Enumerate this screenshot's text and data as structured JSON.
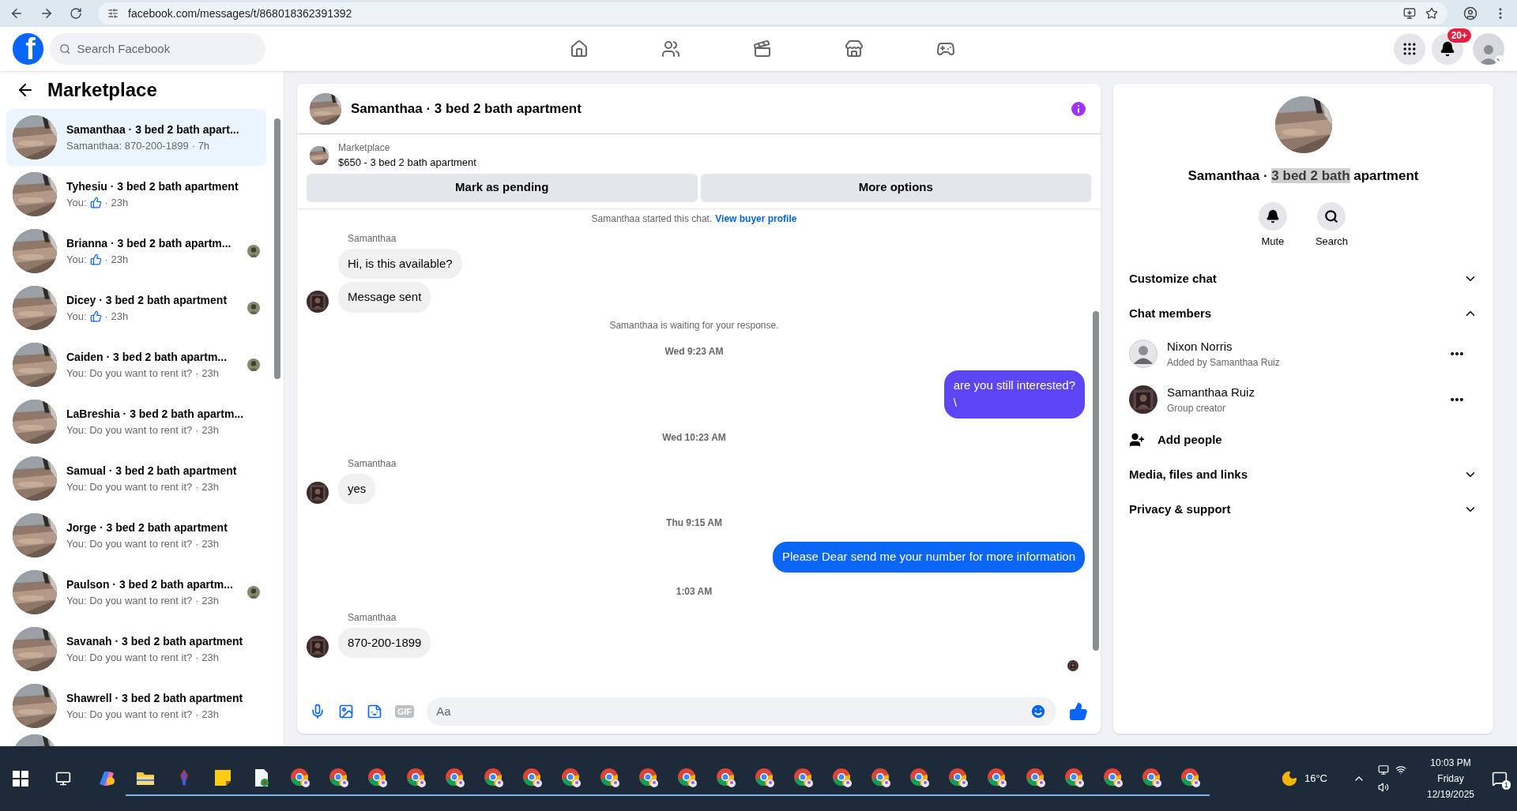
{
  "browser": {
    "url": "facebook.com/messages/t/868018362391392"
  },
  "nav": {
    "logo": "f",
    "search_placeholder": "Search Facebook",
    "notification_badge": "20+"
  },
  "sidebar": {
    "title": "Marketplace",
    "conversations": [
      {
        "title": "Samanthaa · 3 bed 2 bath apart...",
        "kind": "text",
        "preview": "Samanthaa: 870-200-1899",
        "time": "· 7h",
        "selected": true,
        "seen": false
      },
      {
        "title": "Tyhesiu · 3 bed 2 bath apartment",
        "kind": "like",
        "preview": "You:",
        "time": "· 23h",
        "selected": false,
        "seen": false
      },
      {
        "title": "Brianna · 3 bed 2 bath apartm...",
        "kind": "like",
        "preview": "You:",
        "time": "· 23h",
        "selected": false,
        "seen": true
      },
      {
        "title": "Dicey · 3 bed 2 bath apartment",
        "kind": "like",
        "preview": "You:",
        "time": "· 23h",
        "selected": false,
        "seen": true
      },
      {
        "title": "Caiden · 3 bed 2 bath apartm...",
        "kind": "text",
        "preview": "You: Do you want to rent it?",
        "time": "· 23h",
        "selected": false,
        "seen": true
      },
      {
        "title": "LaBreshia · 3 bed 2 bath apartm...",
        "kind": "text",
        "preview": "You: Do you want to rent it?",
        "time": "· 23h",
        "selected": false,
        "seen": false
      },
      {
        "title": "Samual · 3 bed 2 bath apartment",
        "kind": "text",
        "preview": "You: Do you want to rent it?",
        "time": "· 23h",
        "selected": false,
        "seen": false
      },
      {
        "title": "Jorge · 3 bed 2 bath apartment",
        "kind": "text",
        "preview": "You: Do you want to rent it?",
        "time": "· 23h",
        "selected": false,
        "seen": false
      },
      {
        "title": "Paulson · 3 bed 2 bath apartm...",
        "kind": "text",
        "preview": "You: Do you want to rent it?",
        "time": "· 23h",
        "selected": false,
        "seen": true
      },
      {
        "title": "Savanah · 3 bed 2 bath apartment",
        "kind": "text",
        "preview": "You: Do you want to rent it?",
        "time": "· 23h",
        "selected": false,
        "seen": false
      },
      {
        "title": "Shawrell · 3 bed 2 bath apartment",
        "kind": "text",
        "preview": "You: Do you want to rent it?",
        "time": "· 23h",
        "selected": false,
        "seen": false
      }
    ]
  },
  "chat": {
    "title": "Samanthaa · 3 bed 2 bath apartment",
    "listing": {
      "source": "Marketplace",
      "title": "$650 - 3 bed 2 bath apartment"
    },
    "actions": [
      "Mark as pending",
      "More options"
    ],
    "messages": [
      {
        "kind": "system",
        "text": "Samanthaa started this chat.",
        "link": "View buyer profile"
      },
      {
        "kind": "incoming",
        "sender": "Samanthaa",
        "bubbles": [
          "Hi, is this available?",
          "Message sent"
        ]
      },
      {
        "kind": "system",
        "text": "Samanthaa is waiting for your response."
      },
      {
        "kind": "time",
        "text": "Wed 9:23 AM"
      },
      {
        "kind": "outgoing",
        "text": "are you still interested?\n\\",
        "color": "#5b45f5"
      },
      {
        "kind": "time",
        "text": "Wed 10:23 AM"
      },
      {
        "kind": "incoming",
        "sender": "Samanthaa",
        "bubbles": [
          "yes"
        ]
      },
      {
        "kind": "time",
        "text": "Thu 9:15 AM"
      },
      {
        "kind": "outgoing",
        "text": "Please Dear send me your number for more information",
        "color": "#0a66f5"
      },
      {
        "kind": "time",
        "text": "1:03 AM"
      },
      {
        "kind": "incoming",
        "sender": "Samanthaa",
        "bubbles": [
          "870-200-1899"
        ]
      }
    ],
    "composer": {
      "gif": "GIF",
      "placeholder": "Aa"
    }
  },
  "details": {
    "title": "Samanthaa · ",
    "title_highlight": "3 bed 2 bath",
    "title_rest": " apartment",
    "buttons": [
      "Mute",
      "Search"
    ],
    "sections": [
      {
        "label": "Customize chat",
        "expanded": false
      },
      {
        "label": "Chat members",
        "expanded": true,
        "members": [
          {
            "name": "Nixon Norris",
            "role": "Added by Samanthaa Ruiz",
            "kind": "blank"
          },
          {
            "name": "Samanthaa Ruiz",
            "role": "Group creator"
          }
        ],
        "add": "Add people"
      },
      {
        "label": "Media, files and links",
        "expanded": false
      },
      {
        "label": "Privacy & support",
        "expanded": false
      }
    ]
  },
  "taskbar": {
    "apps": [
      {
        "kind": "copilot"
      },
      {
        "kind": "explorer"
      },
      {
        "kind": "tool"
      },
      {
        "kind": "notes"
      },
      {
        "kind": "file"
      },
      {
        "kind": "chrome"
      },
      {
        "kind": "chrome"
      },
      {
        "kind": "chrome"
      },
      {
        "kind": "chrome"
      },
      {
        "kind": "chrome"
      },
      {
        "kind": "chrome"
      },
      {
        "kind": "chrome"
      },
      {
        "kind": "chrome"
      },
      {
        "kind": "chrome"
      },
      {
        "kind": "chrome"
      },
      {
        "kind": "chrome"
      },
      {
        "kind": "chrome"
      },
      {
        "kind": "chrome"
      },
      {
        "kind": "chrome"
      },
      {
        "kind": "chrome"
      },
      {
        "kind": "chrome"
      },
      {
        "kind": "chrome"
      },
      {
        "kind": "chrome"
      },
      {
        "kind": "chrome"
      },
      {
        "kind": "chrome"
      },
      {
        "kind": "chrome"
      },
      {
        "kind": "chrome"
      },
      {
        "kind": "chrome"
      },
      {
        "kind": "chrome"
      }
    ],
    "weather": "16°C",
    "time": "10:03 PM",
    "day": "Friday",
    "date": "12/19/2025",
    "notifications": "1"
  }
}
